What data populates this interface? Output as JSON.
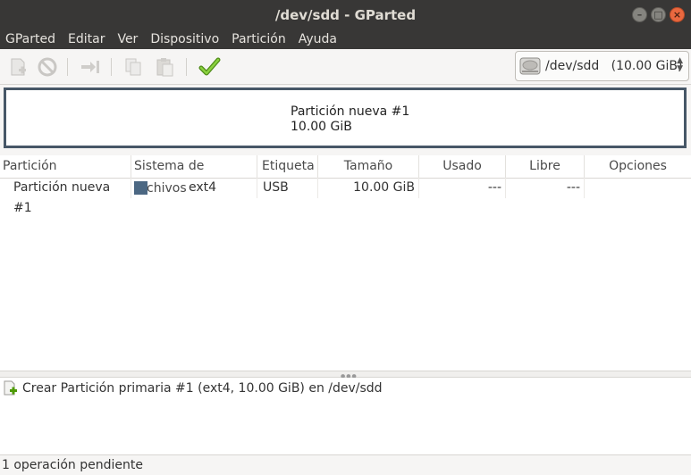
{
  "window": {
    "title": "/dev/sdd - GParted"
  },
  "menubar": {
    "items": [
      "GParted",
      "Editar",
      "Ver",
      "Dispositivo",
      "Partición",
      "Ayuda"
    ]
  },
  "toolbar": {
    "buttons": [
      {
        "icon": "new-partition-icon",
        "enabled": false
      },
      {
        "icon": "delete-icon",
        "enabled": false
      },
      {
        "icon": "resize-move-icon",
        "enabled": false
      },
      {
        "icon": "copy-icon",
        "enabled": false
      },
      {
        "icon": "paste-icon",
        "enabled": false
      },
      {
        "icon": "apply-checkmark-icon",
        "enabled": true
      }
    ],
    "device": {
      "label": "/dev/sdd   (10.00 GiB)",
      "icon": "hard-disk-icon"
    }
  },
  "disk_graphic": {
    "name": "Partición nueva #1",
    "size": "10.00 GiB",
    "border_color": "#475767"
  },
  "table": {
    "headers": [
      "Partición",
      "Sistema de archivos",
      "Etiqueta",
      "Tamaño",
      "Usado",
      "Libre",
      "Opciones"
    ],
    "rows": [
      {
        "partition": "Partición nueva #1",
        "filesystem": "ext4",
        "fs_color": "#4b6782",
        "label": "USB",
        "size": "10.00 GiB",
        "used": "---",
        "free": "---",
        "flags": ""
      }
    ]
  },
  "operations": [
    {
      "icon": "new-partition-icon",
      "text": "Crear Partición primaria #1 (ext4, 10.00 GiB) en /dev/sdd"
    }
  ],
  "status": {
    "text": "1 operación pendiente"
  }
}
